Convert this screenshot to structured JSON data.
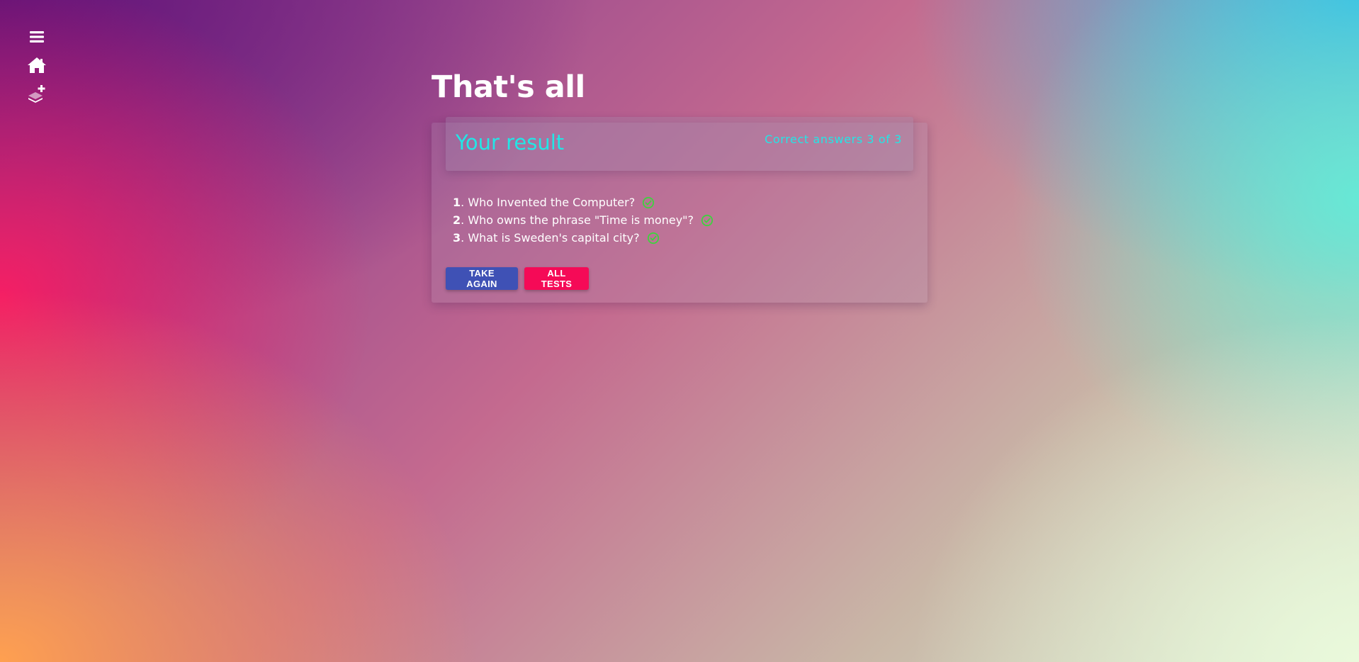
{
  "sidebar": {
    "items": [
      {
        "icon": "menu-icon"
      },
      {
        "icon": "home-icon"
      },
      {
        "icon": "add-test-icon"
      }
    ]
  },
  "page": {
    "title": "That's all"
  },
  "result": {
    "heading": "Your result",
    "score_text": "Correct answers 3 of 3",
    "accent_color": "#22e6e6",
    "answers": [
      {
        "number": "1",
        "question": "Who Invented the Computer?",
        "correct": true
      },
      {
        "number": "2",
        "question": "Who owns the phrase \"Time is money\"?",
        "correct": true
      },
      {
        "number": "3",
        "question": "What is Sweden's capital city?",
        "correct": true
      }
    ]
  },
  "actions": {
    "take_again_label": "Take again",
    "all_tests_label": "All tests",
    "take_again_color": "#3f51b5",
    "all_tests_color": "#f50a57"
  },
  "status_colors": {
    "correct": "#3fd23f"
  }
}
